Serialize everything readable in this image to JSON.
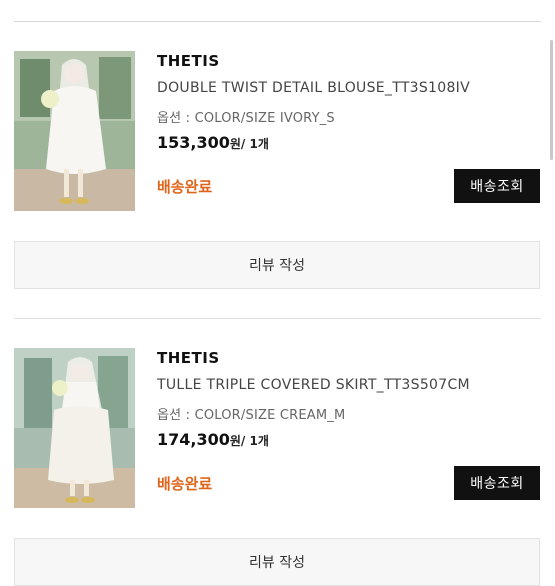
{
  "orders": [
    {
      "brand": "THETIS",
      "name": "DOUBLE TWIST DETAIL BLOUSE_TT3S108IV",
      "option": "옵션 : COLOR/SIZE IVORY_S",
      "price": "153,300",
      "price_unit": "원/ 1개",
      "status": "배송완료",
      "track_label": "배송조회",
      "review_label": "리뷰 작성",
      "image_icon": "product-photo-bride-blouse"
    },
    {
      "brand": "THETIS",
      "name": "TULLE TRIPLE COVERED SKIRT_TT3S507CM",
      "option": "옵션 : COLOR/SIZE CREAM_M",
      "price": "174,300",
      "price_unit": "원/ 1개",
      "status": "배송완료",
      "track_label": "배송조회",
      "review_label": "리뷰 작성",
      "image_icon": "product-photo-bride-skirt"
    }
  ],
  "colors": {
    "status": "#e0651c",
    "track_button_bg": "#111111",
    "review_button_bg": "#f7f7f7"
  }
}
